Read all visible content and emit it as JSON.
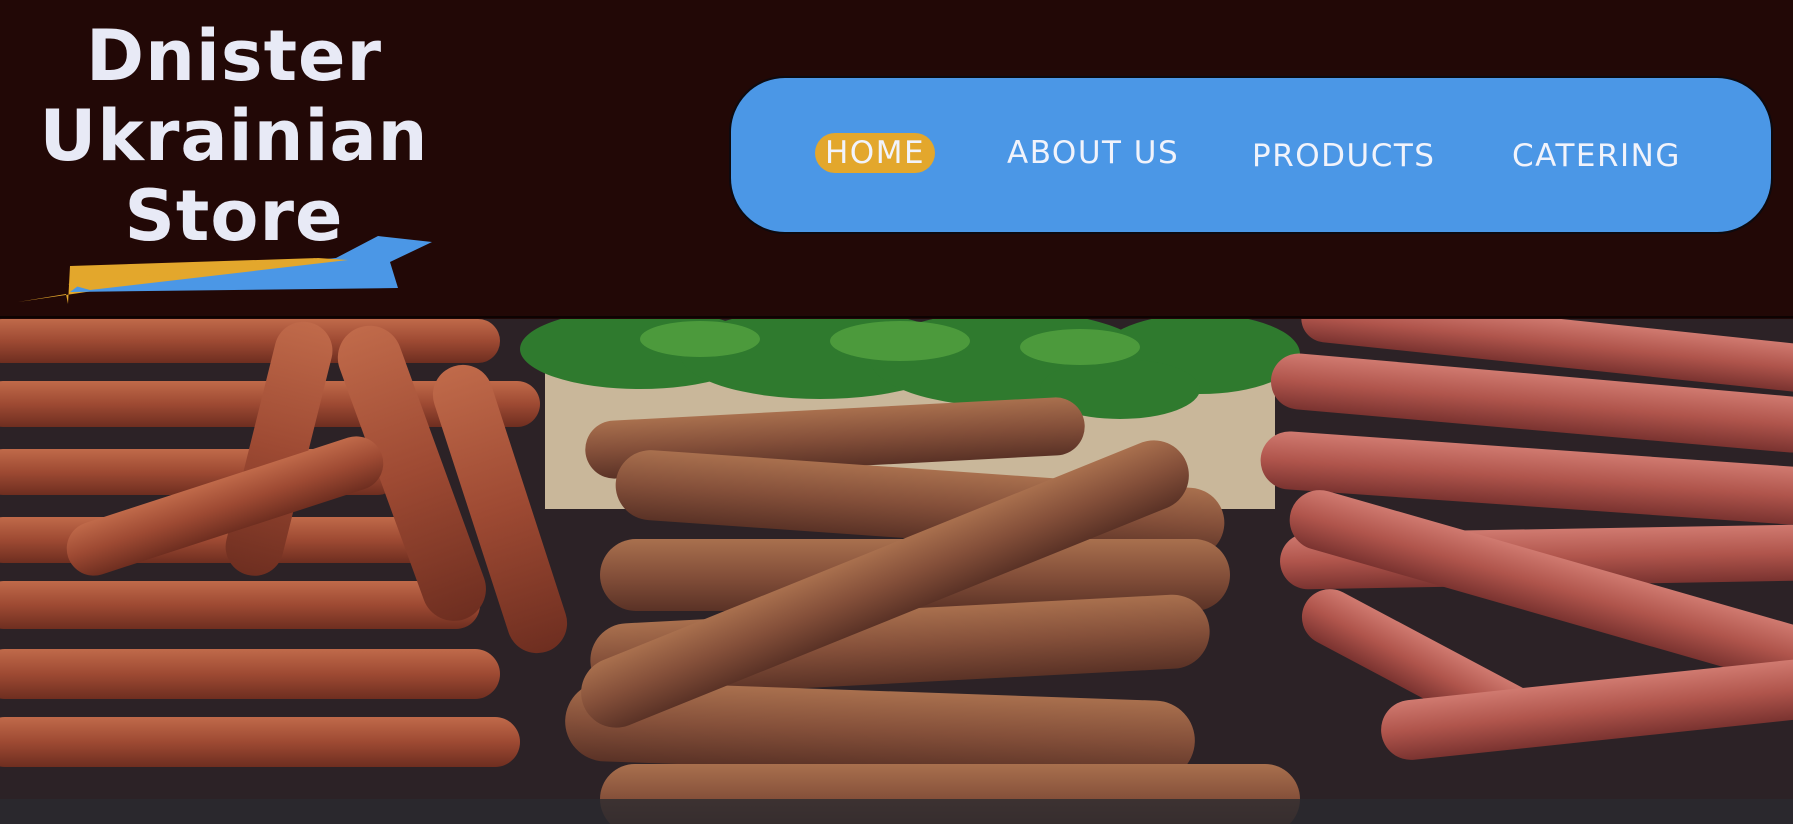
{
  "brand": {
    "line1": "Dnister",
    "line2": "Ukrainian",
    "line3": "Store",
    "colors": {
      "blue": "#4b97e6",
      "gold": "#e3a72c",
      "text": "#e8eaf6"
    }
  },
  "nav": {
    "items": [
      {
        "label": "HOME",
        "active": true
      },
      {
        "label": "ABOUT US",
        "active": false
      },
      {
        "label": "PRODUCTS",
        "active": false
      },
      {
        "label": "CATERING",
        "active": false
      }
    ]
  },
  "hero": {
    "image": "sausages-with-parsley-photo"
  },
  "theme": {
    "header_bg": "#220806",
    "nav_bg": "#4b97e6",
    "active_bg": "#e3a72c"
  }
}
